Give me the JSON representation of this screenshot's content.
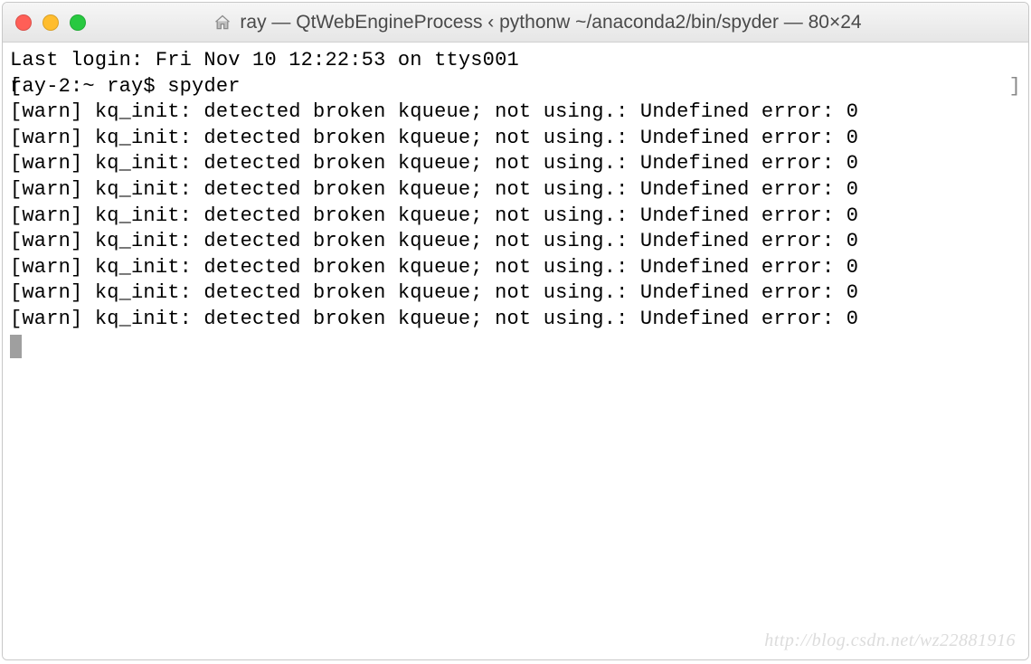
{
  "titlebar": {
    "title": "ray — QtWebEngineProcess ‹ pythonw ~/anaconda2/bin/spyder — 80×24"
  },
  "terminal": {
    "last_login": "Last login: Fri Nov 10 12:22:53 on ttys001",
    "prompt_prefix": "ray-2:~ ray$ ",
    "command": "spyder",
    "warn_line": "[warn] kq_init: detected broken kqueue; not using.: Undefined error: 0",
    "warn_count": 9
  },
  "watermark": "http://blog.csdn.net/wz22881916"
}
